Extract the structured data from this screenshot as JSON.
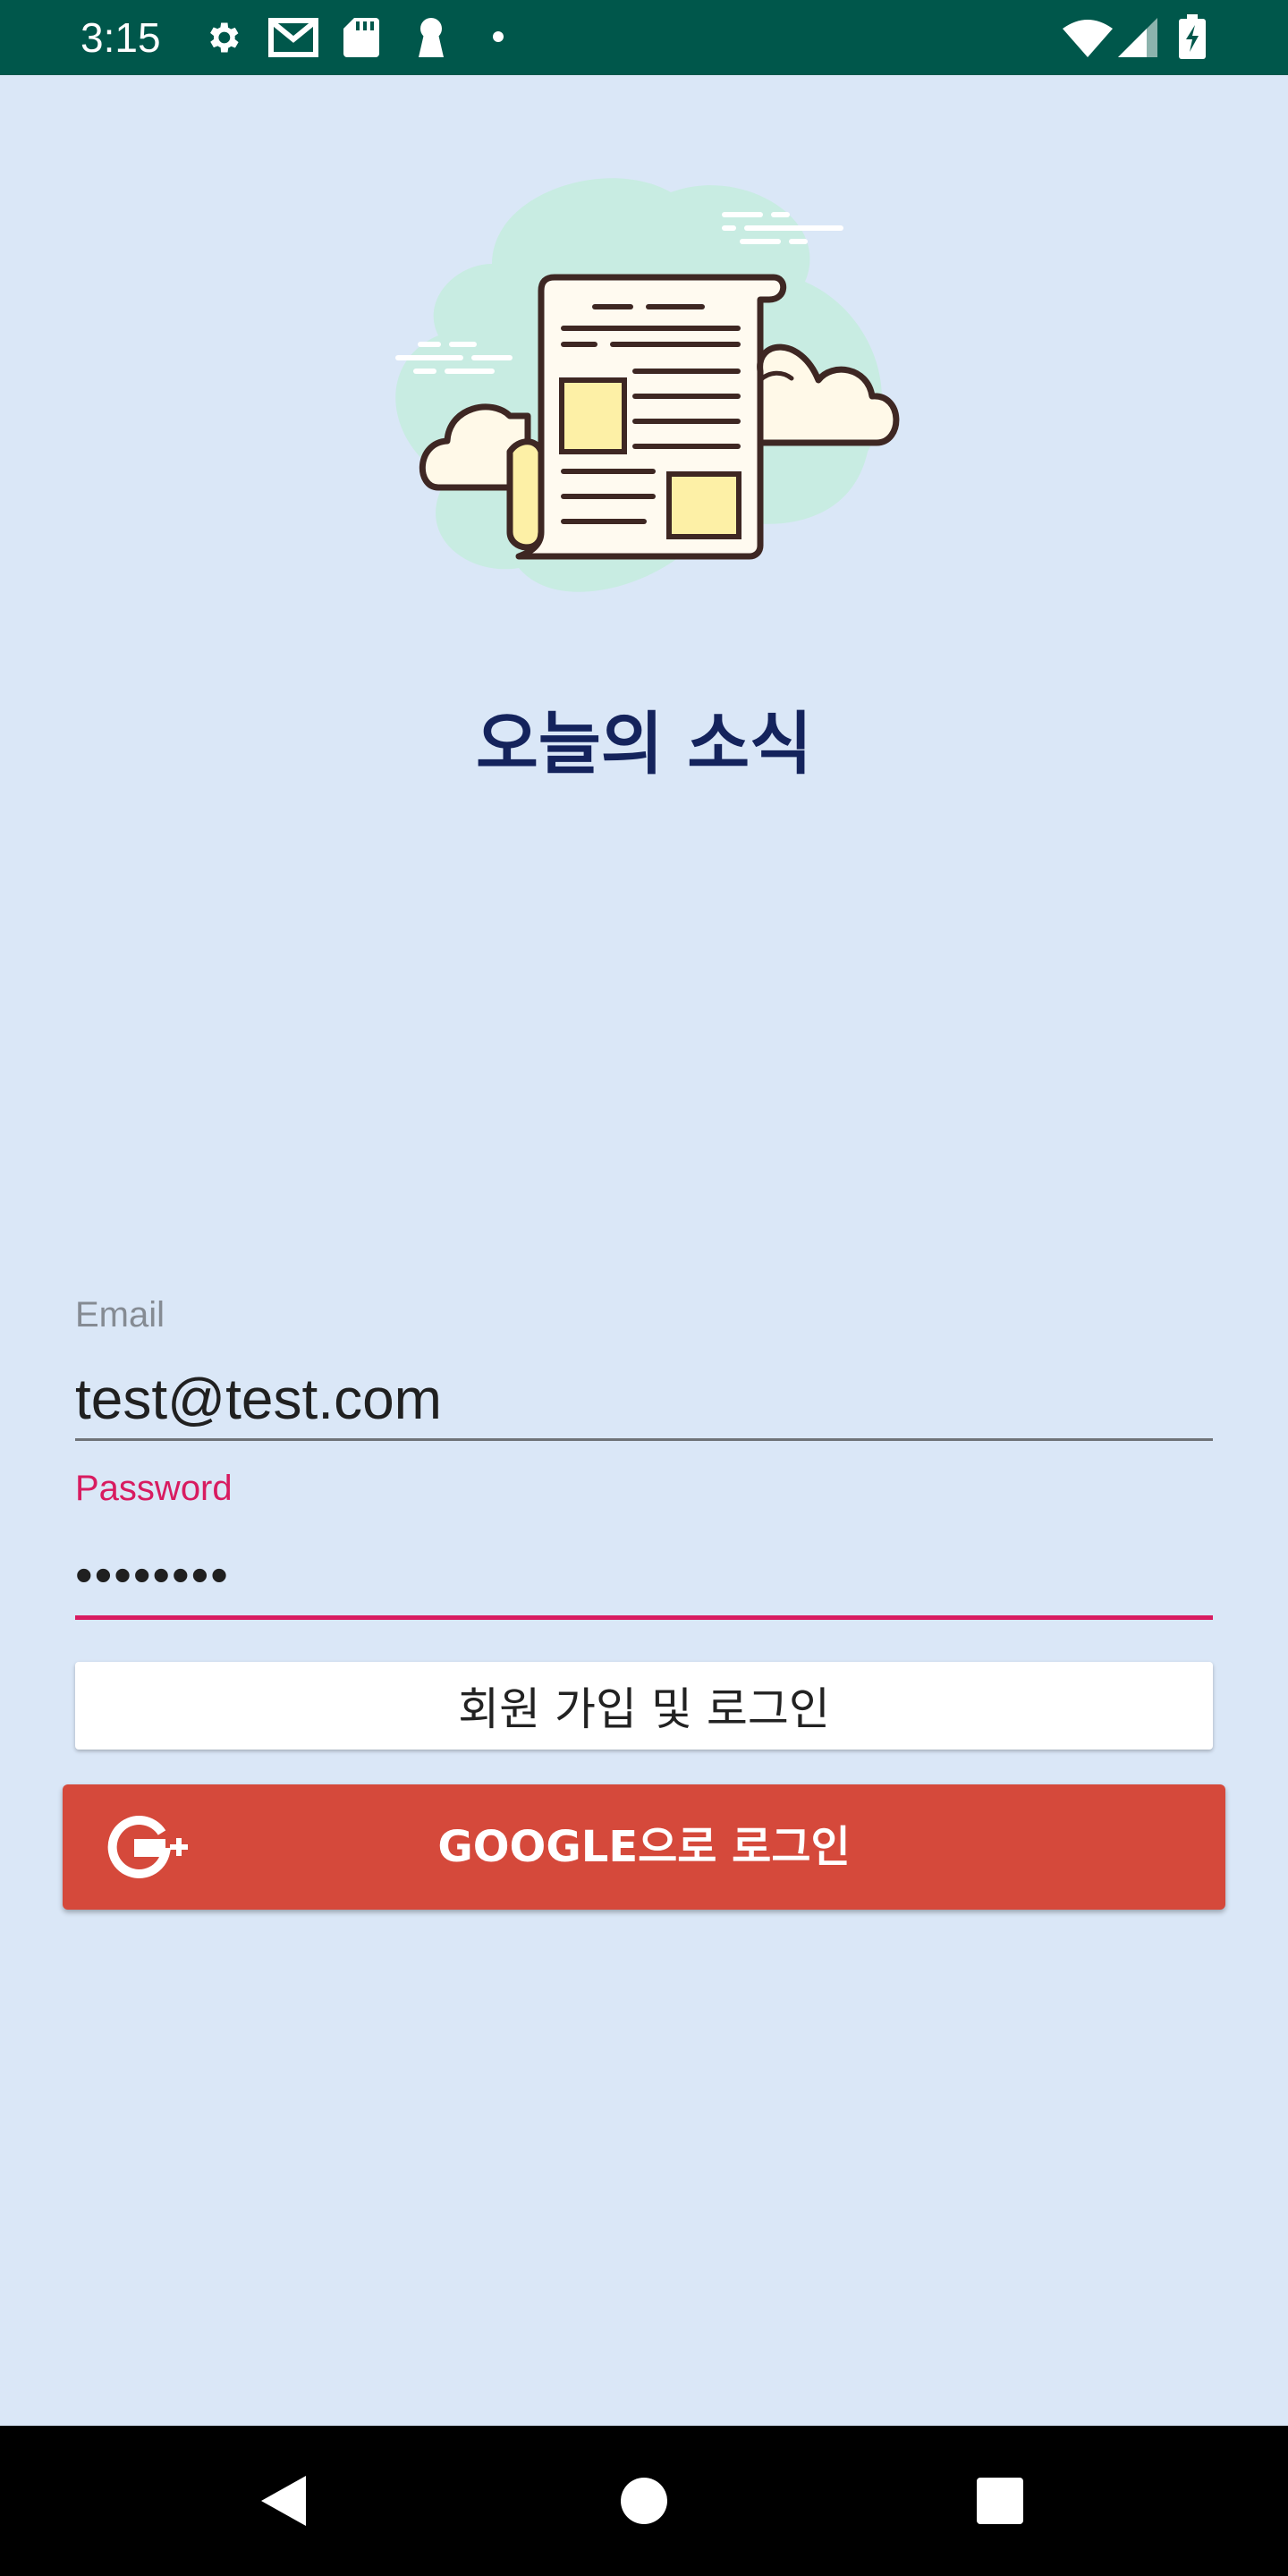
{
  "status_bar": {
    "time": "3:15",
    "left_icons": [
      "gear-icon",
      "gmail-icon",
      "sd-card-icon",
      "keyhole-icon",
      "dot-icon"
    ],
    "right_icons": [
      "wifi-icon",
      "cell-signal-icon",
      "battery-charging-icon"
    ]
  },
  "app": {
    "title": "오늘의 소식",
    "illustration": "newspaper-clouds-icon"
  },
  "login": {
    "email_label": "Email",
    "email_value": "test@test.com",
    "password_label": "Password",
    "password_value": "password",
    "signup_button": "회원 가입 및 로그인",
    "google_button": "GOOGLE으로 로그인",
    "google_icon": "google-plus-icon"
  },
  "nav_bar": {
    "buttons": [
      "back-icon",
      "home-icon",
      "recents-icon"
    ]
  },
  "colors": {
    "background": "#dae7f7",
    "status_bar": "#00574b",
    "title": "#14235c",
    "accent": "#d81b60",
    "google": "#d5493b"
  }
}
